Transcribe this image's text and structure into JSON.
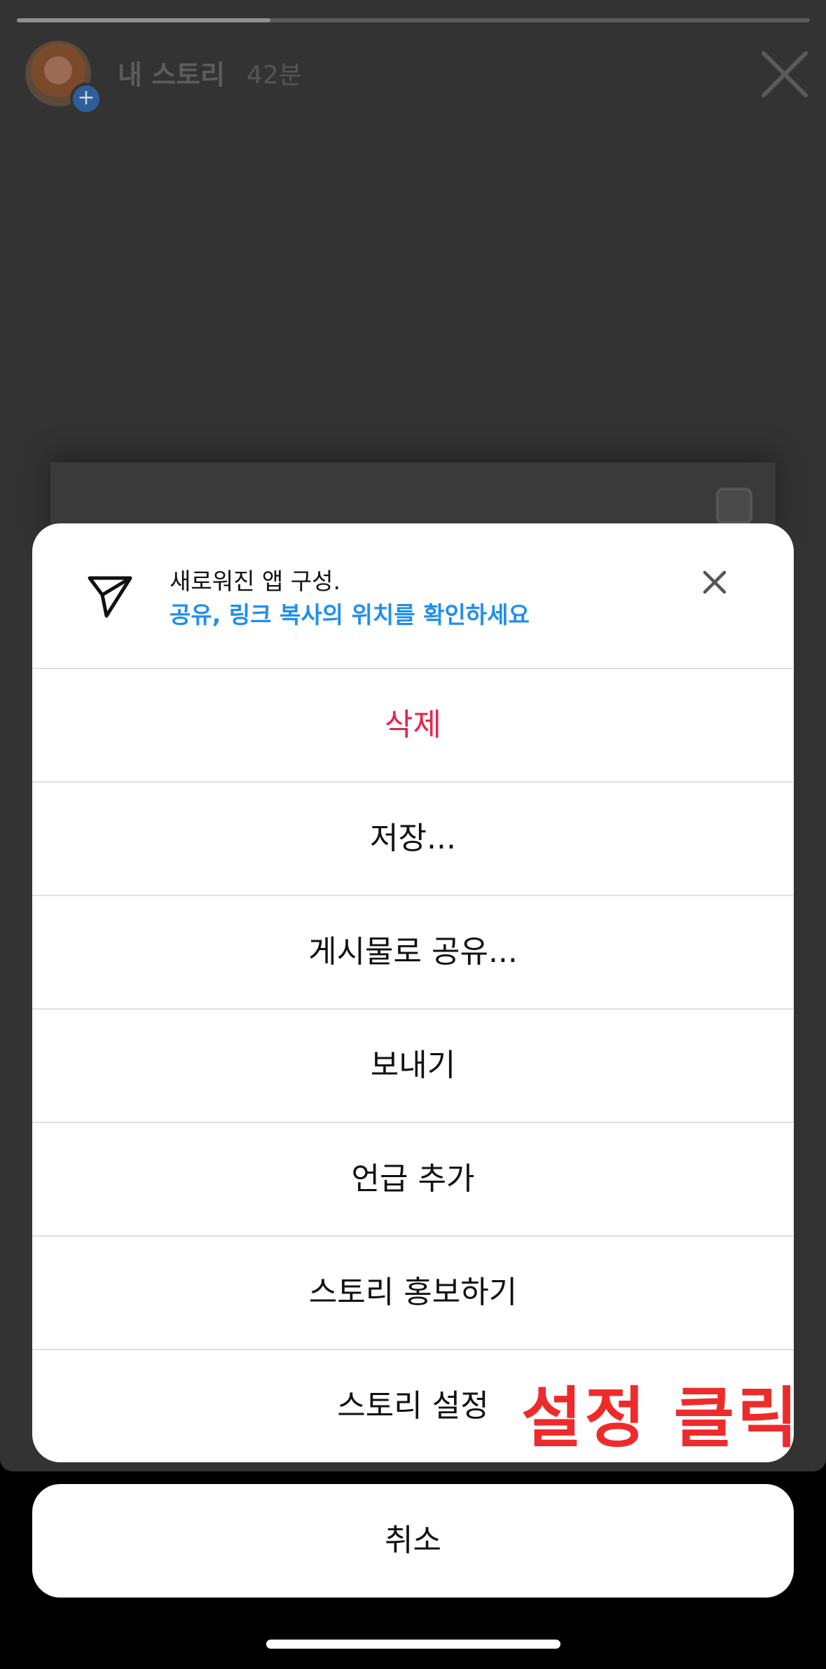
{
  "story": {
    "username": "내 스토리",
    "time": "42분",
    "progress": 0.32
  },
  "banner": {
    "title": "새로워진 앱 구성.",
    "link": "공유, 링크 복사의 위치를 확인하세요"
  },
  "menu": {
    "items": [
      {
        "label": "삭제",
        "style": "danger"
      },
      {
        "label": "저장..."
      },
      {
        "label": "게시물로 공유..."
      },
      {
        "label": "보내기"
      },
      {
        "label": "언급 추가"
      },
      {
        "label": "스토리 홍보하기"
      },
      {
        "label": "스토리 설정"
      }
    ]
  },
  "annotation": "설정 클릭",
  "cancel_label": "취소",
  "colors": {
    "danger": "#e8224a",
    "link": "#1f8ff0",
    "annotation": "#ee2b2b"
  }
}
